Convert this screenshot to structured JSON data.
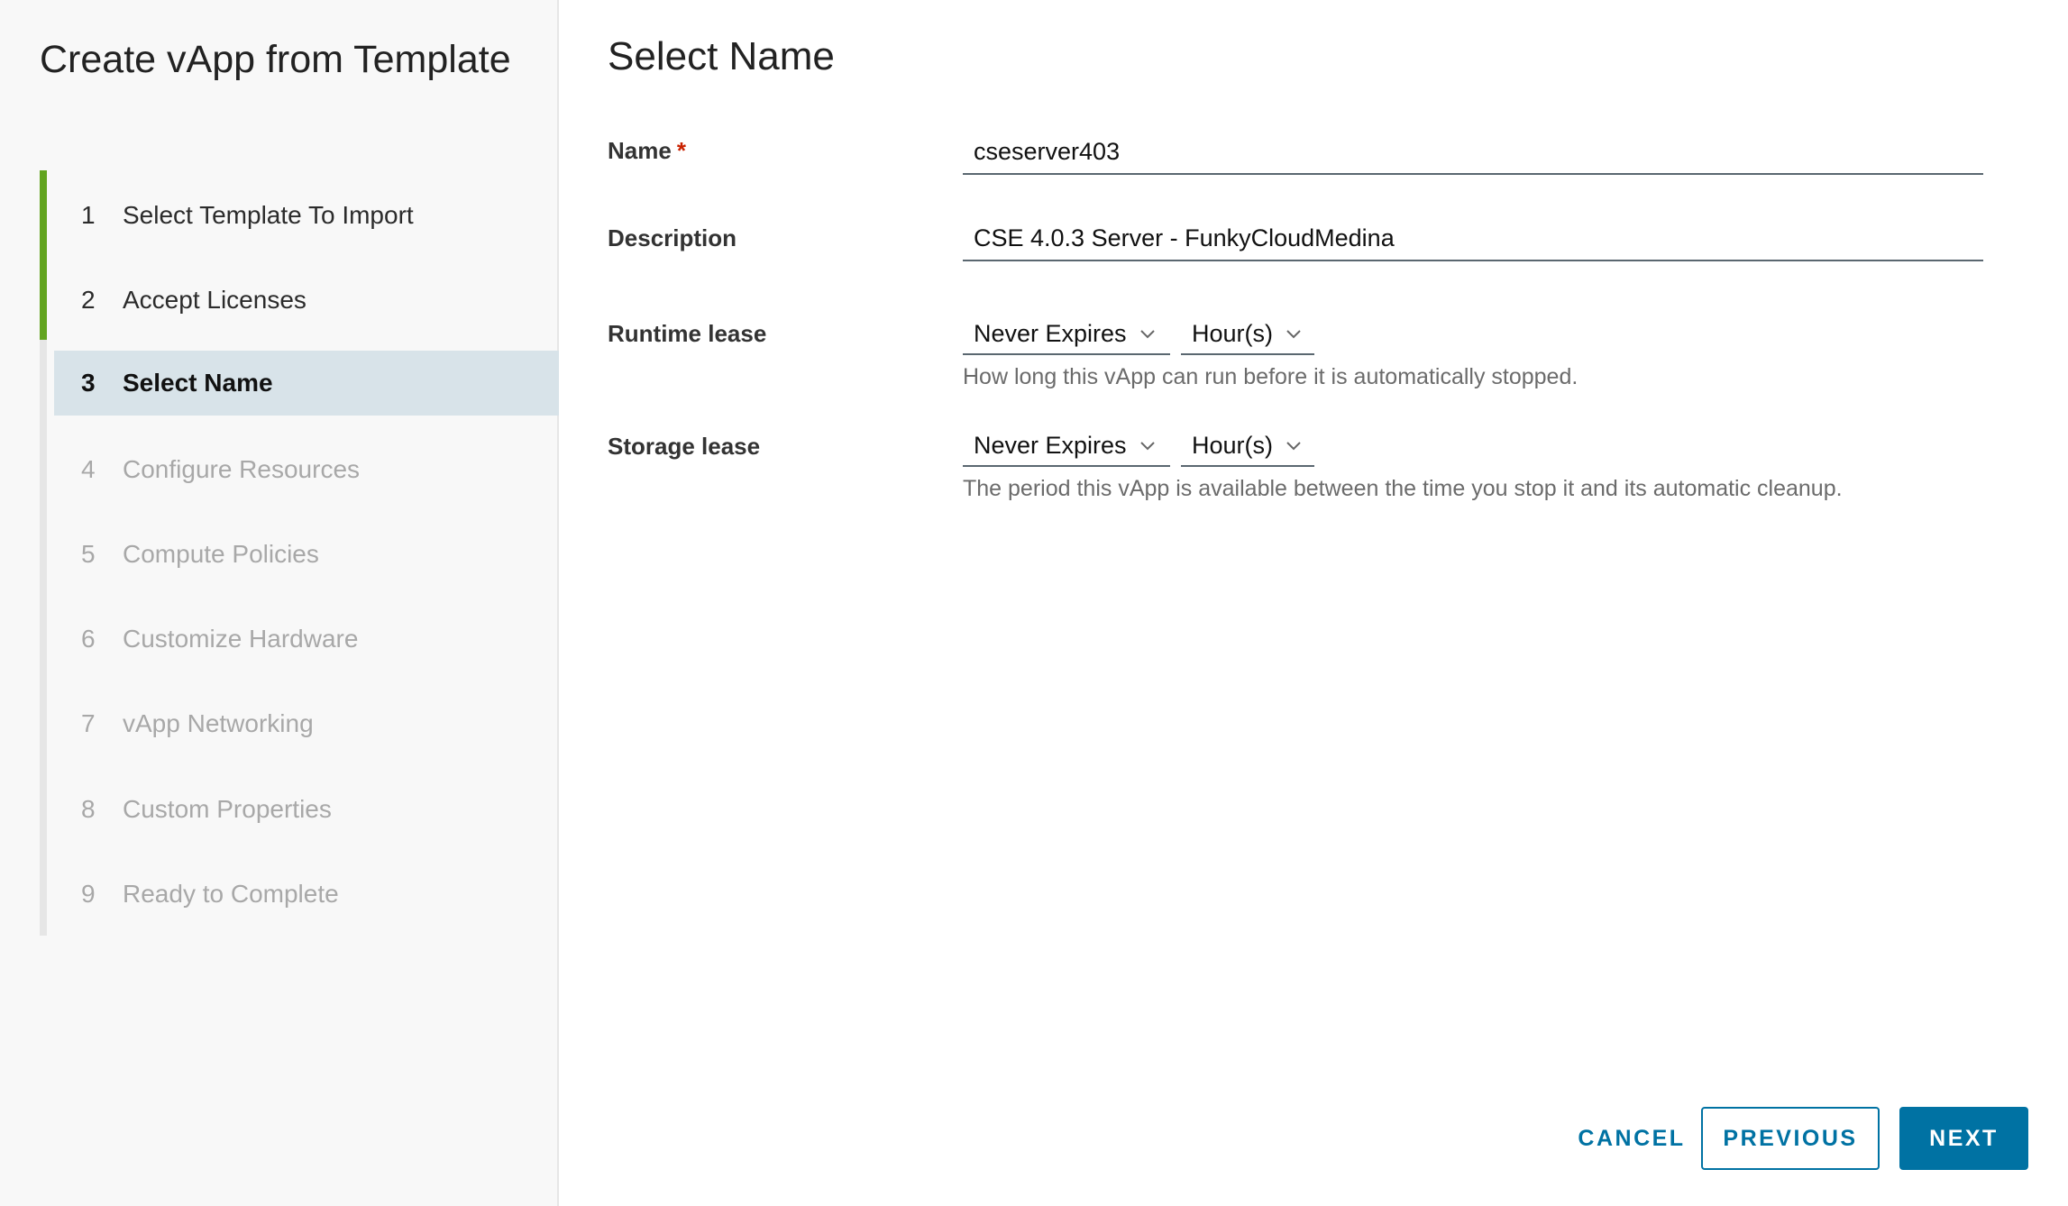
{
  "wizard": {
    "title": "Create vApp from Template",
    "steps": [
      {
        "num": "1",
        "label": "Select Template To Import",
        "state": "done"
      },
      {
        "num": "2",
        "label": "Accept Licenses",
        "state": "done"
      },
      {
        "num": "3",
        "label": "Select Name",
        "state": "active"
      },
      {
        "num": "4",
        "label": "Configure Resources",
        "state": "pending"
      },
      {
        "num": "5",
        "label": "Compute Policies",
        "state": "pending"
      },
      {
        "num": "6",
        "label": "Customize Hardware",
        "state": "pending"
      },
      {
        "num": "7",
        "label": "vApp Networking",
        "state": "pending"
      },
      {
        "num": "8",
        "label": "Custom Properties",
        "state": "pending"
      },
      {
        "num": "9",
        "label": "Ready to Complete",
        "state": "pending"
      }
    ]
  },
  "page": {
    "title": "Select Name",
    "name": {
      "label": "Name",
      "required_mark": "*",
      "value": "cseserver403"
    },
    "description": {
      "label": "Description",
      "value": "CSE 4.0.3 Server - FunkyCloudMedina"
    },
    "runtime_lease": {
      "label": "Runtime lease",
      "duration": "Never Expires",
      "unit": "Hour(s)",
      "helper": "How long this vApp can run before it is automatically stopped."
    },
    "storage_lease": {
      "label": "Storage lease",
      "duration": "Never Expires",
      "unit": "Hour(s)",
      "helper": "The period this vApp is available between the time you stop it and its automatic cleanup."
    }
  },
  "footer": {
    "cancel": "CANCEL",
    "previous": "PREVIOUS",
    "next": "NEXT"
  },
  "colors": {
    "accent": "#0072a3",
    "step_done": "#62a420",
    "active_step_bg": "#d8e3e9",
    "required": "#c92100"
  },
  "icons": {
    "select_chevron": "chevron-down-icon"
  }
}
